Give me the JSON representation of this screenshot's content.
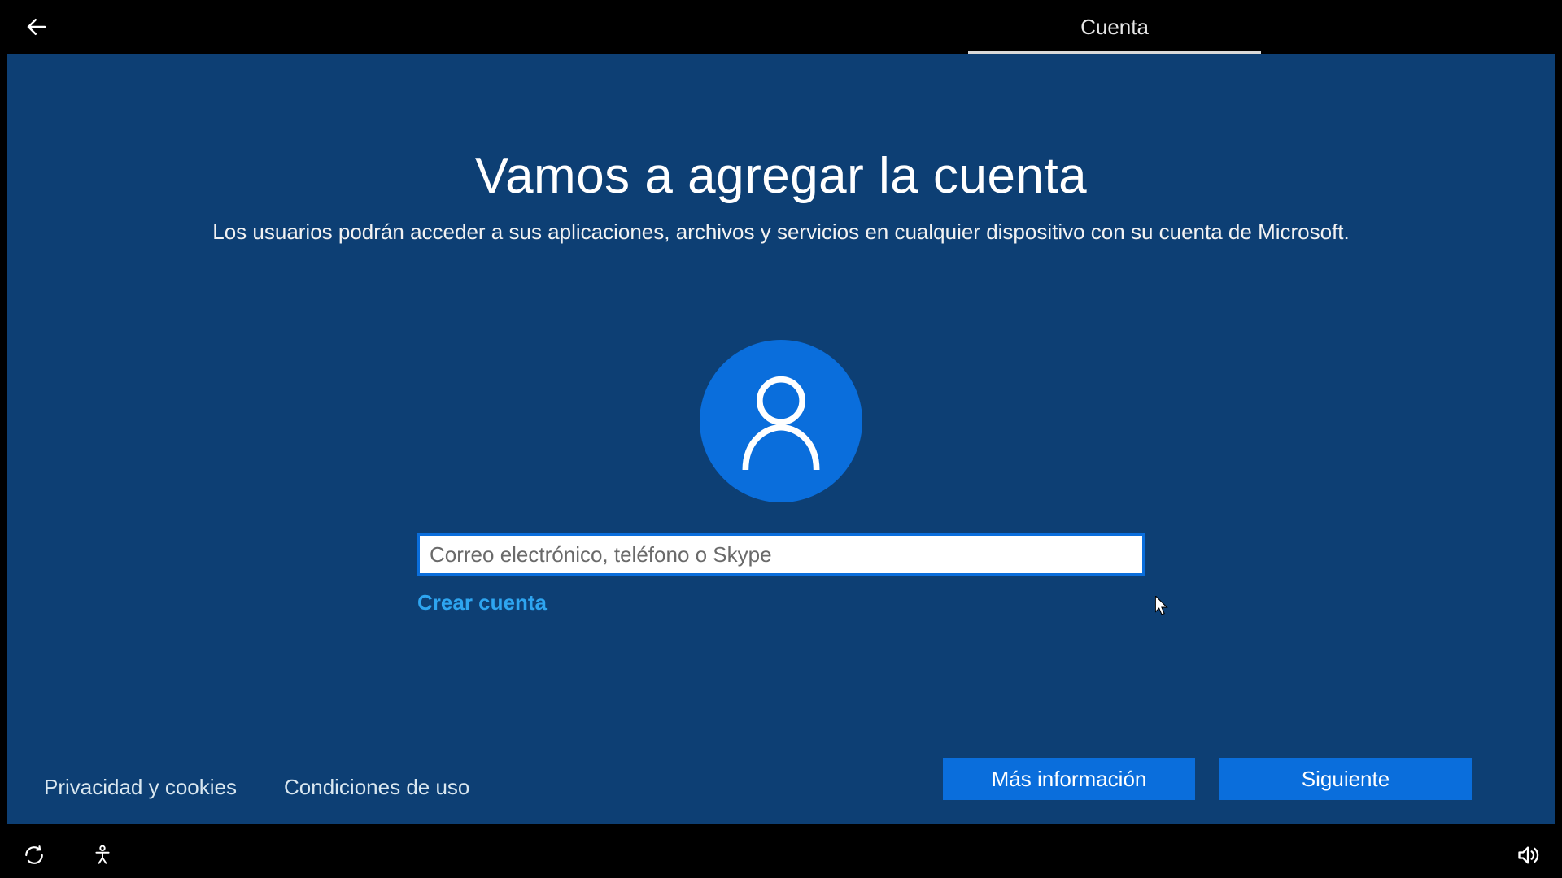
{
  "header": {
    "tab_label": "Cuenta"
  },
  "main": {
    "headline": "Vamos a agregar la cuenta",
    "subhead": "Los usuarios podrán acceder a sus aplicaciones, archivos y servicios en cualquier dispositivo con su cuenta de Microsoft.",
    "email_placeholder": "Correo electrónico, teléfono o Skype",
    "email_value": "",
    "create_account": "Crear cuenta"
  },
  "footer": {
    "privacy": "Privacidad y cookies",
    "terms": "Condiciones de uso",
    "more_info": "Más información",
    "next": "Siguiente"
  },
  "icons": {
    "back": "back-arrow",
    "avatar": "user-avatar",
    "ease_of_access": "ease-of-access",
    "power": "power-cycle",
    "volume": "volume"
  },
  "colors": {
    "panel_bg": "#0d3f74",
    "accent": "#0a6edc",
    "link": "#2ea5f0"
  }
}
